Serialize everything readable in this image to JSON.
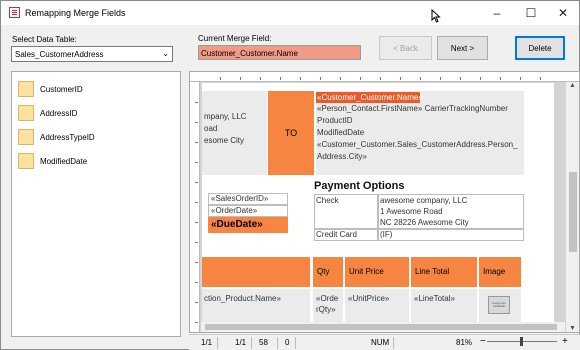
{
  "window": {
    "title": "Remapping Merge Fields",
    "controls": [
      "–",
      "☐",
      "✕"
    ]
  },
  "left_panel": {
    "select_label": "Select Data Table:",
    "selected_table": "Sales_CustomerAddress",
    "fields": [
      "CustomerID",
      "AddressID",
      "AddressTypeID",
      "ModifiedDate"
    ]
  },
  "merge_field": {
    "label": "Current Merge Field:",
    "value": "Customer_Customer.Name"
  },
  "buttons": {
    "back": "< Back",
    "next": "Next >",
    "delete": "Delete"
  },
  "document": {
    "addr_left": [
      "mpany, LLC",
      "oad",
      "esome City"
    ],
    "to_label": "TO",
    "selected_field": "«Customer_Customer.Name»",
    "addr_right": [
      "«Person_Contact.FirstName» CarrierTrackingNumber",
      "ProductID",
      "ModifiedDate",
      "«Customer_Customer.Sales_CustomerAddress.Person_",
      "Address.City»"
    ],
    "order_fields": [
      "«SalesOrderID»",
      "«OrderDate»",
      "«DueDate»"
    ],
    "payment_title": "Payment Options",
    "payments": [
      {
        "method": "Check",
        "detail": [
          "awesome company, LLC",
          "1 Awesome Road",
          "NC 28226 Awesome City"
        ]
      },
      {
        "method": "Credit Card",
        "detail": [
          "(IF)"
        ]
      }
    ],
    "columns": [
      "Qty",
      "Unit Price",
      "Line Total",
      "Image"
    ],
    "row": {
      "product": "ction_Product.Name»",
      "qty": [
        "«Orde",
        "rQty»"
      ],
      "unit_price": "«UnitPrice»",
      "line_total": "«LineTotal»",
      "image_alt": "Image Not Available"
    }
  },
  "status": {
    "page1": "1/1",
    "page2": "1/1",
    "line": "58",
    "col": "0",
    "num": "NUM",
    "zoom": "81%",
    "zoom_minus": "−",
    "zoom_plus": "+"
  },
  "colors": {
    "accent_orange": "#f78542",
    "selection": "#e95b2b",
    "merge_field_bg": "#f19a85"
  }
}
